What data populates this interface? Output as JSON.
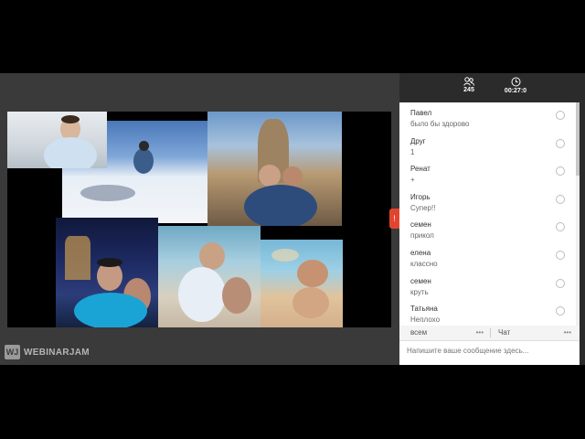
{
  "stats": {
    "attendees": "245",
    "timer": "00:27:0"
  },
  "chat": {
    "messages": [
      {
        "name": "Павел",
        "text": "было бы здорово"
      },
      {
        "name": "Друг",
        "text": "1"
      },
      {
        "name": "Ренат",
        "text": "+"
      },
      {
        "name": "Игорь",
        "text": "Супер!!"
      },
      {
        "name": "семен",
        "text": "прикол"
      },
      {
        "name": "елена",
        "text": "классно"
      },
      {
        "name": "семен",
        "text": "круть"
      },
      {
        "name": "Татьяна",
        "text": "Неплохо"
      }
    ],
    "recipient": "всем",
    "mode": "Чат",
    "placeholder": "Напишите ваше сообщение здесь..."
  },
  "branding": {
    "logo_mark": "WJ",
    "logo_text": "WEBINARJAM"
  },
  "colors": {
    "accent": "#e2452f",
    "header": "#2b2b2b",
    "stage_bg": "#3a3a3a"
  }
}
